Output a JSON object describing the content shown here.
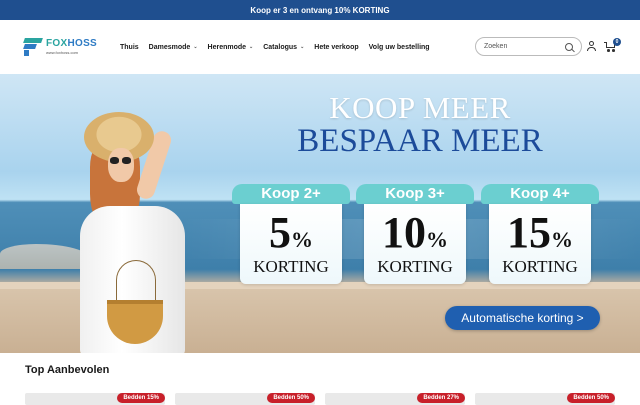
{
  "announcement": "Koop er 3 en ontvang 10% KORTING",
  "logo": {
    "name_part1": "FOX",
    "name_part2": "HOSS",
    "url": "www.foxhoss.com"
  },
  "nav": [
    {
      "label": "Thuis",
      "dropdown": false
    },
    {
      "label": "Damesmode",
      "dropdown": true
    },
    {
      "label": "Herenmode",
      "dropdown": true
    },
    {
      "label": "Catalogus",
      "dropdown": true
    },
    {
      "label": "Hete verkoop",
      "dropdown": false
    },
    {
      "label": "Volg uw bestelling",
      "dropdown": false
    }
  ],
  "search": {
    "placeholder": "Zoeken"
  },
  "cart": {
    "count": "0"
  },
  "hero": {
    "headline_line1": "KOOP MEER",
    "headline_line2": "BESPAAR MEER",
    "offers": [
      {
        "tab": "Koop 2+",
        "percent": "5",
        "percent_sign": "%",
        "label": "KORTING"
      },
      {
        "tab": "Koop 3+",
        "percent": "10",
        "percent_sign": "%",
        "label": "KORTING"
      },
      {
        "tab": "Koop 4+",
        "percent": "15",
        "percent_sign": "%",
        "label": "KORTING"
      }
    ],
    "button": "Automatische korting >"
  },
  "section": {
    "title": "Top Aanbevolen"
  },
  "products": [
    {
      "badge": "Bedden 15%"
    },
    {
      "badge": "Bedden 50%"
    },
    {
      "badge": "Bedden 27%"
    },
    {
      "badge": "Bedden 50%"
    }
  ],
  "colors": {
    "brand_blue": "#1f4f8f",
    "accent_teal": "#6bcfd0",
    "sale_red": "#c8202a"
  }
}
